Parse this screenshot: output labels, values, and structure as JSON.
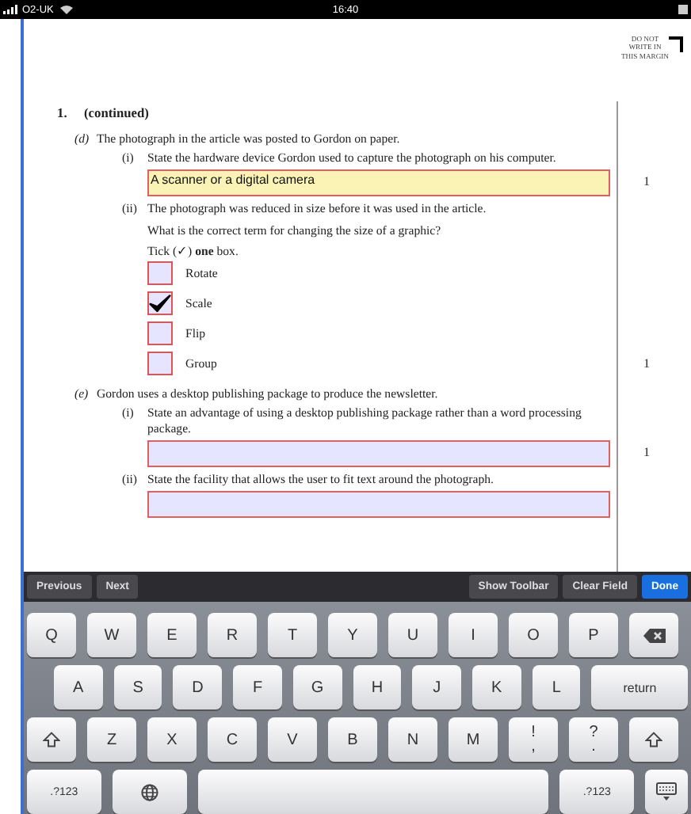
{
  "status_bar": {
    "carrier": "O2-UK",
    "time": "16:40"
  },
  "margin_note": "DO NOT WRITE IN THIS MARGIN",
  "question": {
    "number": "1.",
    "heading": "(continued)"
  },
  "parts": [
    {
      "label": "(d)",
      "text": "The photograph in the article was posted to Gordon on paper.",
      "subparts": [
        {
          "label": "(i)",
          "kind": "text",
          "prompt": [
            "State the hardware device Gordon used to capture the photograph on his computer."
          ],
          "answer": "A scanner or a digital camera",
          "focused": true,
          "mark": "1"
        },
        {
          "label": "(ii)",
          "kind": "tick",
          "prompt": [
            "The photograph was reduced in size before it was used in the article.",
            "What is the correct term for changing the size of a graphic?",
            "Tick (✓) **one** box."
          ],
          "options": [
            {
              "label": "Rotate",
              "checked": false
            },
            {
              "label": "Scale",
              "checked": true
            },
            {
              "label": "Flip",
              "checked": false
            },
            {
              "label": "Group",
              "checked": false
            }
          ],
          "mark": "1"
        }
      ]
    },
    {
      "label": "(e)",
      "text": "Gordon uses a desktop publishing package to produce the newsletter.",
      "subparts": [
        {
          "label": "(i)",
          "kind": "text",
          "prompt": [
            "State an advantage of using a desktop publishing package rather than a word processing package."
          ],
          "focused": false,
          "mark": "1"
        },
        {
          "label": "(ii)",
          "kind": "text",
          "prompt": [
            "State the facility that allows the user to fit text around the photograph."
          ],
          "focused": false
        }
      ]
    }
  ],
  "toolbar": [
    {
      "label": "Previous",
      "kind": "nav"
    },
    {
      "label": "Next",
      "kind": "nav"
    },
    {
      "label": "Show Toolbar",
      "kind": "action"
    },
    {
      "label": "Clear Field",
      "kind": "action"
    },
    {
      "label": "Done",
      "kind": "primary"
    }
  ],
  "keyboard": [
    [
      {
        "kind": "char",
        "label": "Q"
      },
      {
        "kind": "char",
        "label": "W"
      },
      {
        "kind": "char",
        "label": "E"
      },
      {
        "kind": "char",
        "label": "R"
      },
      {
        "kind": "char",
        "label": "T"
      },
      {
        "kind": "char",
        "label": "Y"
      },
      {
        "kind": "char",
        "label": "U"
      },
      {
        "kind": "char",
        "label": "I"
      },
      {
        "kind": "char",
        "label": "O"
      },
      {
        "kind": "char",
        "label": "P"
      },
      {
        "kind": "delete"
      }
    ],
    [
      {
        "kind": "char",
        "label": "A"
      },
      {
        "kind": "char",
        "label": "S"
      },
      {
        "kind": "char",
        "label": "D"
      },
      {
        "kind": "char",
        "label": "F"
      },
      {
        "kind": "char",
        "label": "G"
      },
      {
        "kind": "char",
        "label": "H"
      },
      {
        "kind": "char",
        "label": "J"
      },
      {
        "kind": "char",
        "label": "K"
      },
      {
        "kind": "char",
        "label": "L"
      },
      {
        "kind": "return",
        "label": "return"
      }
    ],
    [
      {
        "kind": "shift"
      },
      {
        "kind": "char",
        "label": "Z"
      },
      {
        "kind": "char",
        "label": "X"
      },
      {
        "kind": "char",
        "label": "C"
      },
      {
        "kind": "char",
        "label": "V"
      },
      {
        "kind": "char",
        "label": "B"
      },
      {
        "kind": "char",
        "label": "N"
      },
      {
        "kind": "char",
        "label": "M"
      },
      {
        "kind": "punct",
        "top": "!",
        "bottom": ","
      },
      {
        "kind": "punct",
        "top": "?",
        "bottom": "."
      },
      {
        "kind": "shift"
      }
    ],
    [
      {
        "kind": "mode",
        "label": ".?123"
      },
      {
        "kind": "globe"
      },
      {
        "kind": "space"
      },
      {
        "kind": "mode",
        "label": ".?123"
      },
      {
        "kind": "hide"
      }
    ]
  ]
}
